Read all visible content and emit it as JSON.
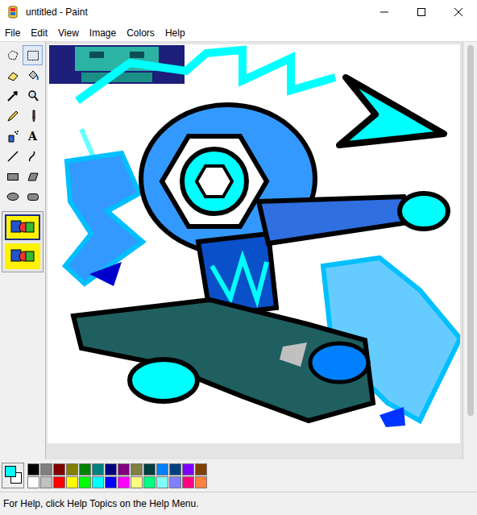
{
  "window": {
    "title": "untitled - Paint"
  },
  "menu": [
    "File",
    "Edit",
    "View",
    "Image",
    "Colors",
    "Help"
  ],
  "tools": [
    {
      "kind": "free-select",
      "selected": false
    },
    {
      "kind": "select",
      "selected": true
    },
    {
      "kind": "eraser",
      "selected": false
    },
    {
      "kind": "fill",
      "selected": false
    },
    {
      "kind": "picker",
      "selected": false
    },
    {
      "kind": "magnifier",
      "selected": false
    },
    {
      "kind": "pencil",
      "selected": false
    },
    {
      "kind": "brush",
      "selected": false
    },
    {
      "kind": "airbrush",
      "selected": false
    },
    {
      "kind": "text",
      "glyph": "A",
      "selected": false
    },
    {
      "kind": "line",
      "selected": false
    },
    {
      "kind": "curve",
      "selected": false
    },
    {
      "kind": "rectangle",
      "selected": false
    },
    {
      "kind": "polygon",
      "selected": false
    },
    {
      "kind": "ellipse",
      "selected": false
    },
    {
      "kind": "rounded-rect",
      "selected": false
    }
  ],
  "tool_options": [
    {
      "selected": true
    },
    {
      "selected": false
    }
  ],
  "colors": {
    "foreground": "#00ffff",
    "background": "#ffffff"
  },
  "palette": [
    {
      "color": "#000000"
    },
    {
      "color": "#808080"
    },
    {
      "color": "#800000"
    },
    {
      "color": "#808000"
    },
    {
      "color": "#008000"
    },
    {
      "color": "#008080"
    },
    {
      "color": "#000080"
    },
    {
      "color": "#800080"
    },
    {
      "color": "#808040"
    },
    {
      "color": "#004040"
    },
    {
      "color": "#0080ff"
    },
    {
      "color": "#004080"
    },
    {
      "color": "#8000ff"
    },
    {
      "color": "#804000"
    },
    {
      "color": "#ffffff"
    },
    {
      "color": "#c0c0c0"
    },
    {
      "color": "#ff0000"
    },
    {
      "color": "#ffff00"
    },
    {
      "color": "#00ff00"
    },
    {
      "color": "#00ffff"
    },
    {
      "color": "#0000ff"
    },
    {
      "color": "#ff00ff"
    },
    {
      "color": "#ffff80"
    },
    {
      "color": "#00ff80"
    },
    {
      "color": "#80ffff"
    },
    {
      "color": "#8080ff"
    },
    {
      "color": "#ff0080"
    },
    {
      "color": "#ff8040"
    }
  ],
  "status_bar": "For Help, click Help Topics on the Help Menu."
}
